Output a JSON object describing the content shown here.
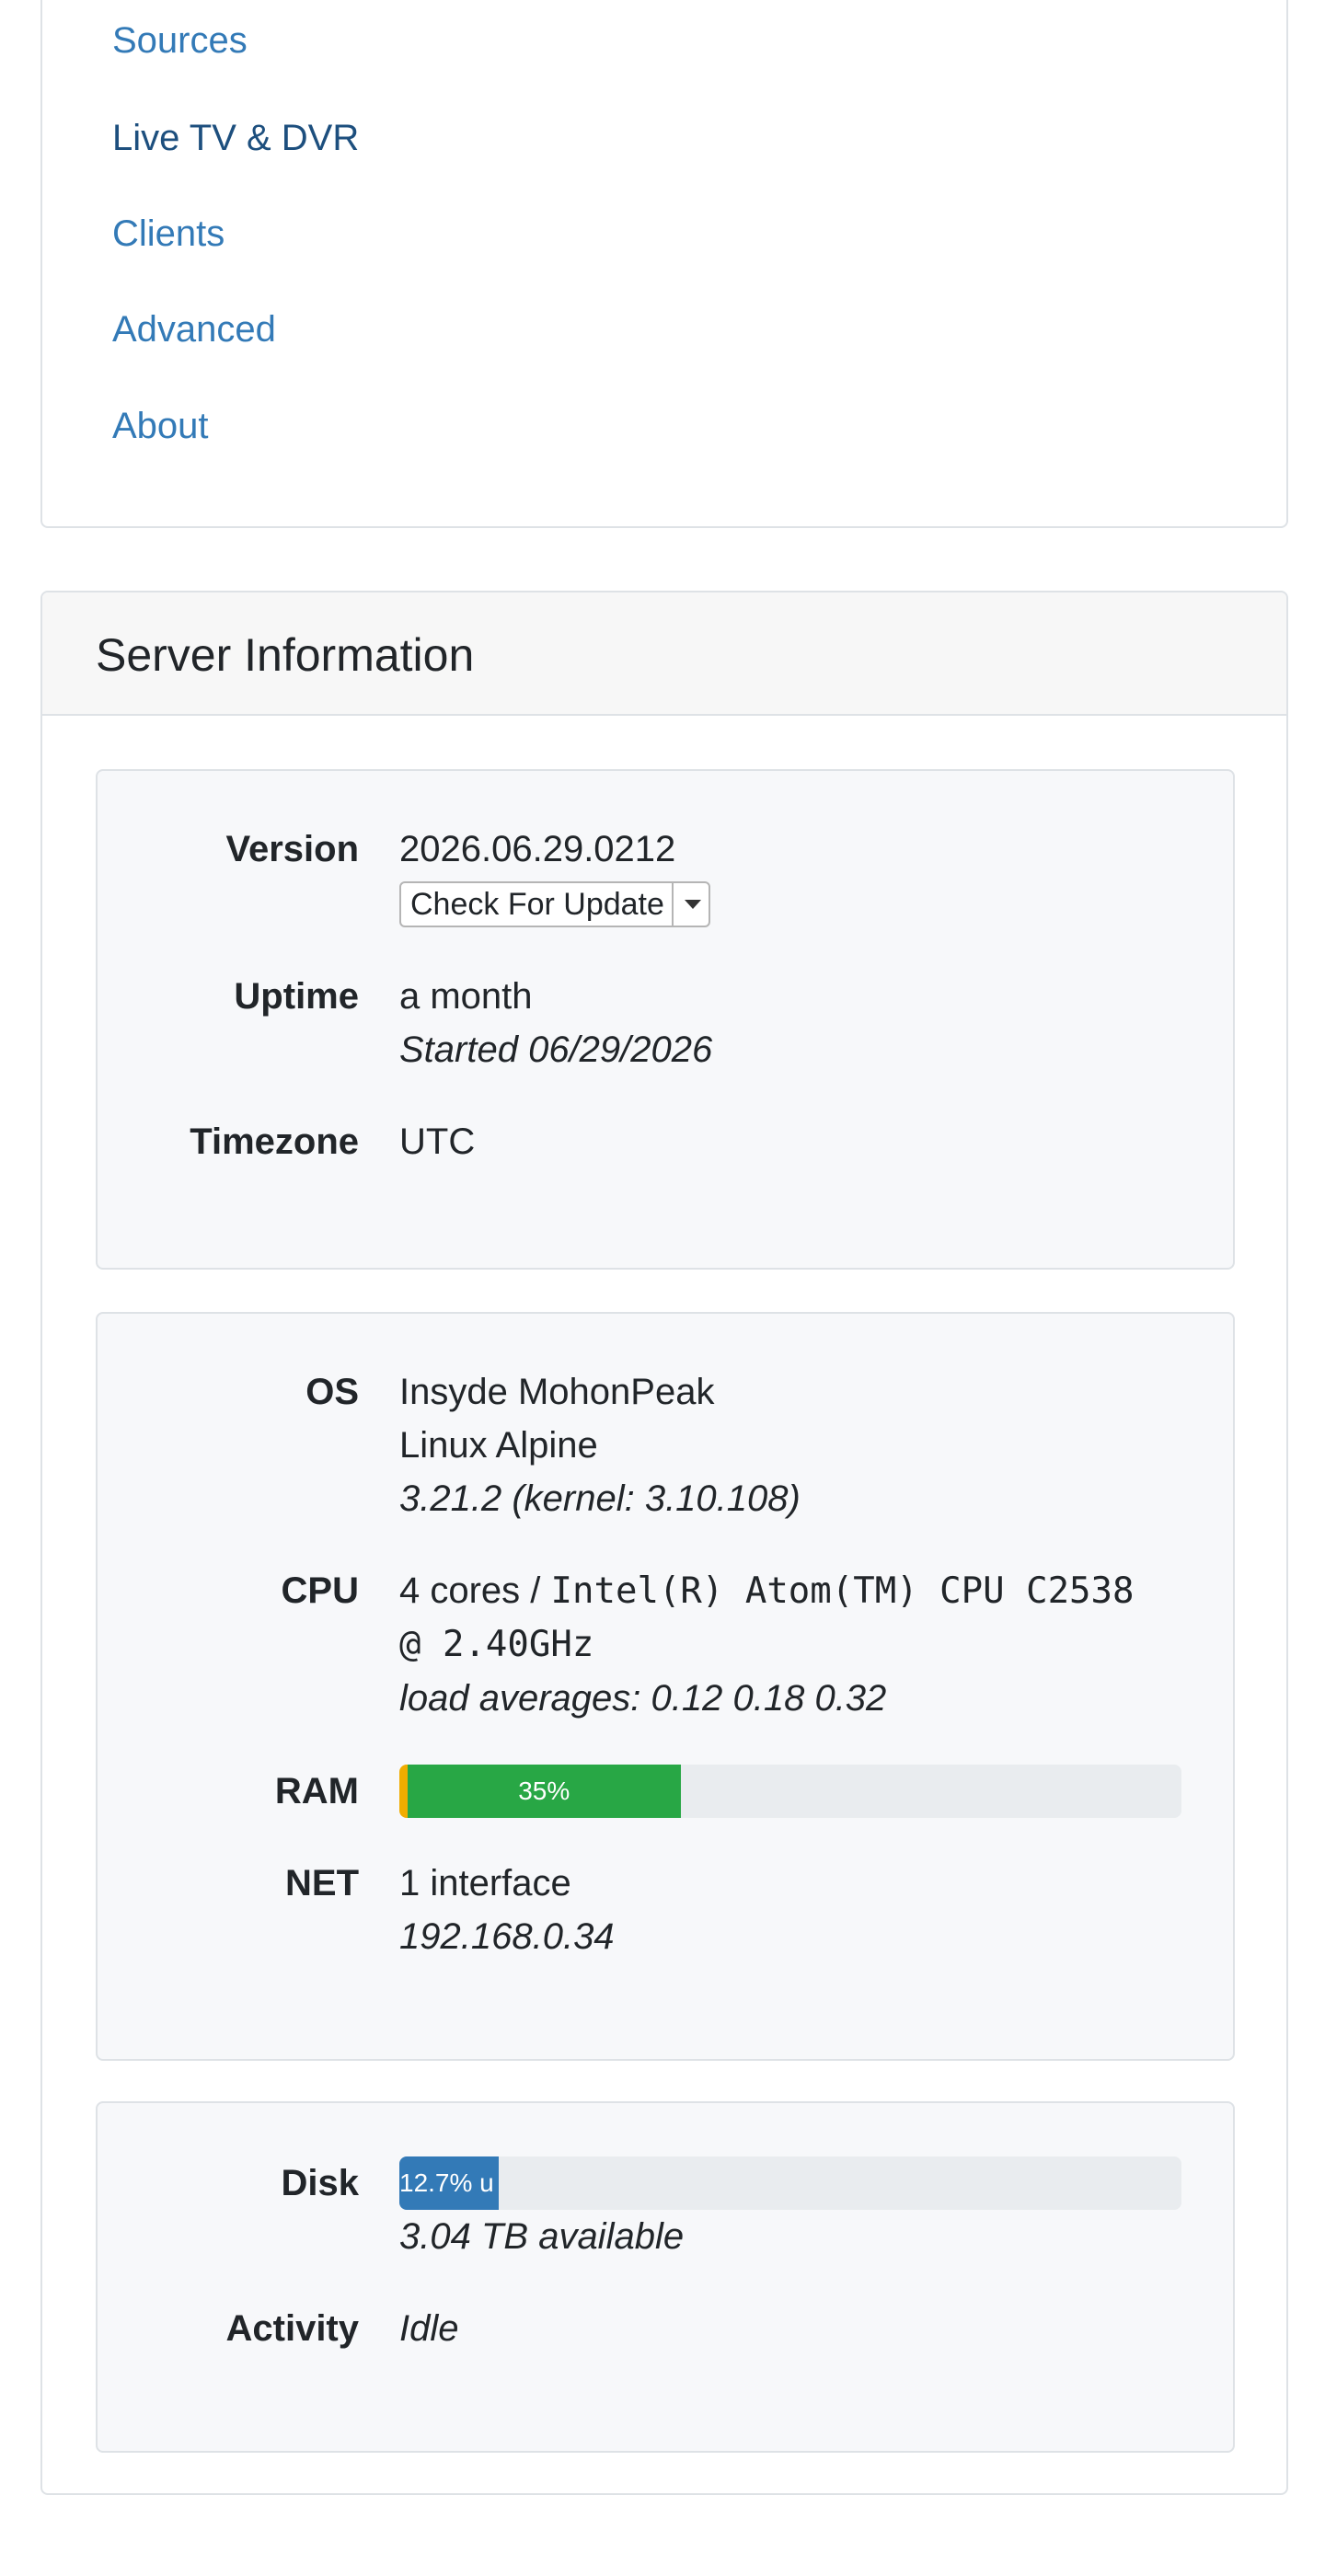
{
  "nav": {
    "items": [
      {
        "label": "Sources"
      },
      {
        "label": "Live TV & DVR"
      },
      {
        "label": "Clients"
      },
      {
        "label": "Advanced"
      },
      {
        "label": "About"
      }
    ]
  },
  "server_info": {
    "title": "Server Information",
    "version": {
      "label": "Version",
      "value": "2026.06.29.0212",
      "update_button": "Check For Update"
    },
    "uptime": {
      "label": "Uptime",
      "value": "a month",
      "started": "Started 06/29/2026"
    },
    "timezone": {
      "label": "Timezone",
      "value": "UTC"
    },
    "os": {
      "label": "OS",
      "line1": "Insyde MohonPeak",
      "line2": "Linux Alpine",
      "line3": "3.21.2 (kernel: 3.10.108)"
    },
    "cpu": {
      "label": "CPU",
      "cores": "4 cores /",
      "model_line1": "Intel(R) Atom(TM) CPU C2538",
      "model_line2": "@ 2.40GHz",
      "load": "load averages:  0.12  0.18  0.32"
    },
    "ram": {
      "label": "RAM",
      "percent_text": "35%",
      "percent": 35,
      "small_segment_percent": 1,
      "colors": {
        "small": "#f0ad00",
        "main": "#28a745",
        "track": "#e9ecef"
      }
    },
    "net": {
      "label": "NET",
      "count": "1 interface",
      "ip": "192.168.0.34"
    },
    "disk": {
      "label": "Disk",
      "bar_text": "12.7% u",
      "percent": 12.7,
      "available": "3.04 TB available",
      "colors": {
        "bar": "#337ab7",
        "track": "#e9ecef"
      }
    },
    "activity": {
      "label": "Activity",
      "value": "Idle"
    }
  },
  "colors": {
    "link": "#337ab7",
    "link_active": "#1d4f7e",
    "border": "#dee2e6"
  }
}
